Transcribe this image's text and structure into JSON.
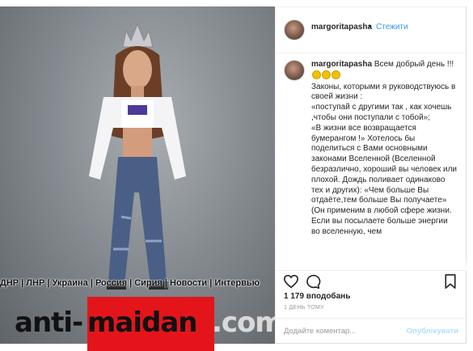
{
  "post": {
    "username": "margoritapasha",
    "separator": "•",
    "follow_label": "Стежити",
    "caption_username": "margoritapasha",
    "caption_lines": [
      "Всем добрый день !!!",
      "Законы, которыми я руководствуюсь в своей жизни :",
      "«поступай с другими так , как хочешь ,чтобы они поступали с тобой»;",
      "«В жизни все возвращается бумерангом !» Хотелось бы поделиться с Вами основными законами Вселенной (Вселенной безразлично, хороший вы человек или плохой. Дождь поливает одинаково тех и других): «Чем больше Вы отдаёте,тем больше Вы получаете»",
      "(Он применим в любой сфере жизни. Если вы посылаете больше энергии во вселенную, чем"
    ],
    "likes": "1 179 вподобань",
    "time_ago": "1 день тому",
    "comment_placeholder": "Додайте коментар...",
    "post_button": "Опублікувати"
  },
  "overlay": {
    "caption_strip": "ДНР | ЛНР | Украина | Россия | Сирия | Новости | Интервью",
    "logo_part1": "anti-",
    "logo_part2": "maidan",
    "logo_part3": ".com",
    "logo_red": "#e3151b"
  },
  "icons": [
    "heart-icon",
    "comment-icon",
    "bookmark-icon",
    "emoji-icon"
  ],
  "colors": {
    "link_blue": "#3897f0",
    "text": "#262626",
    "muted": "#999999"
  }
}
